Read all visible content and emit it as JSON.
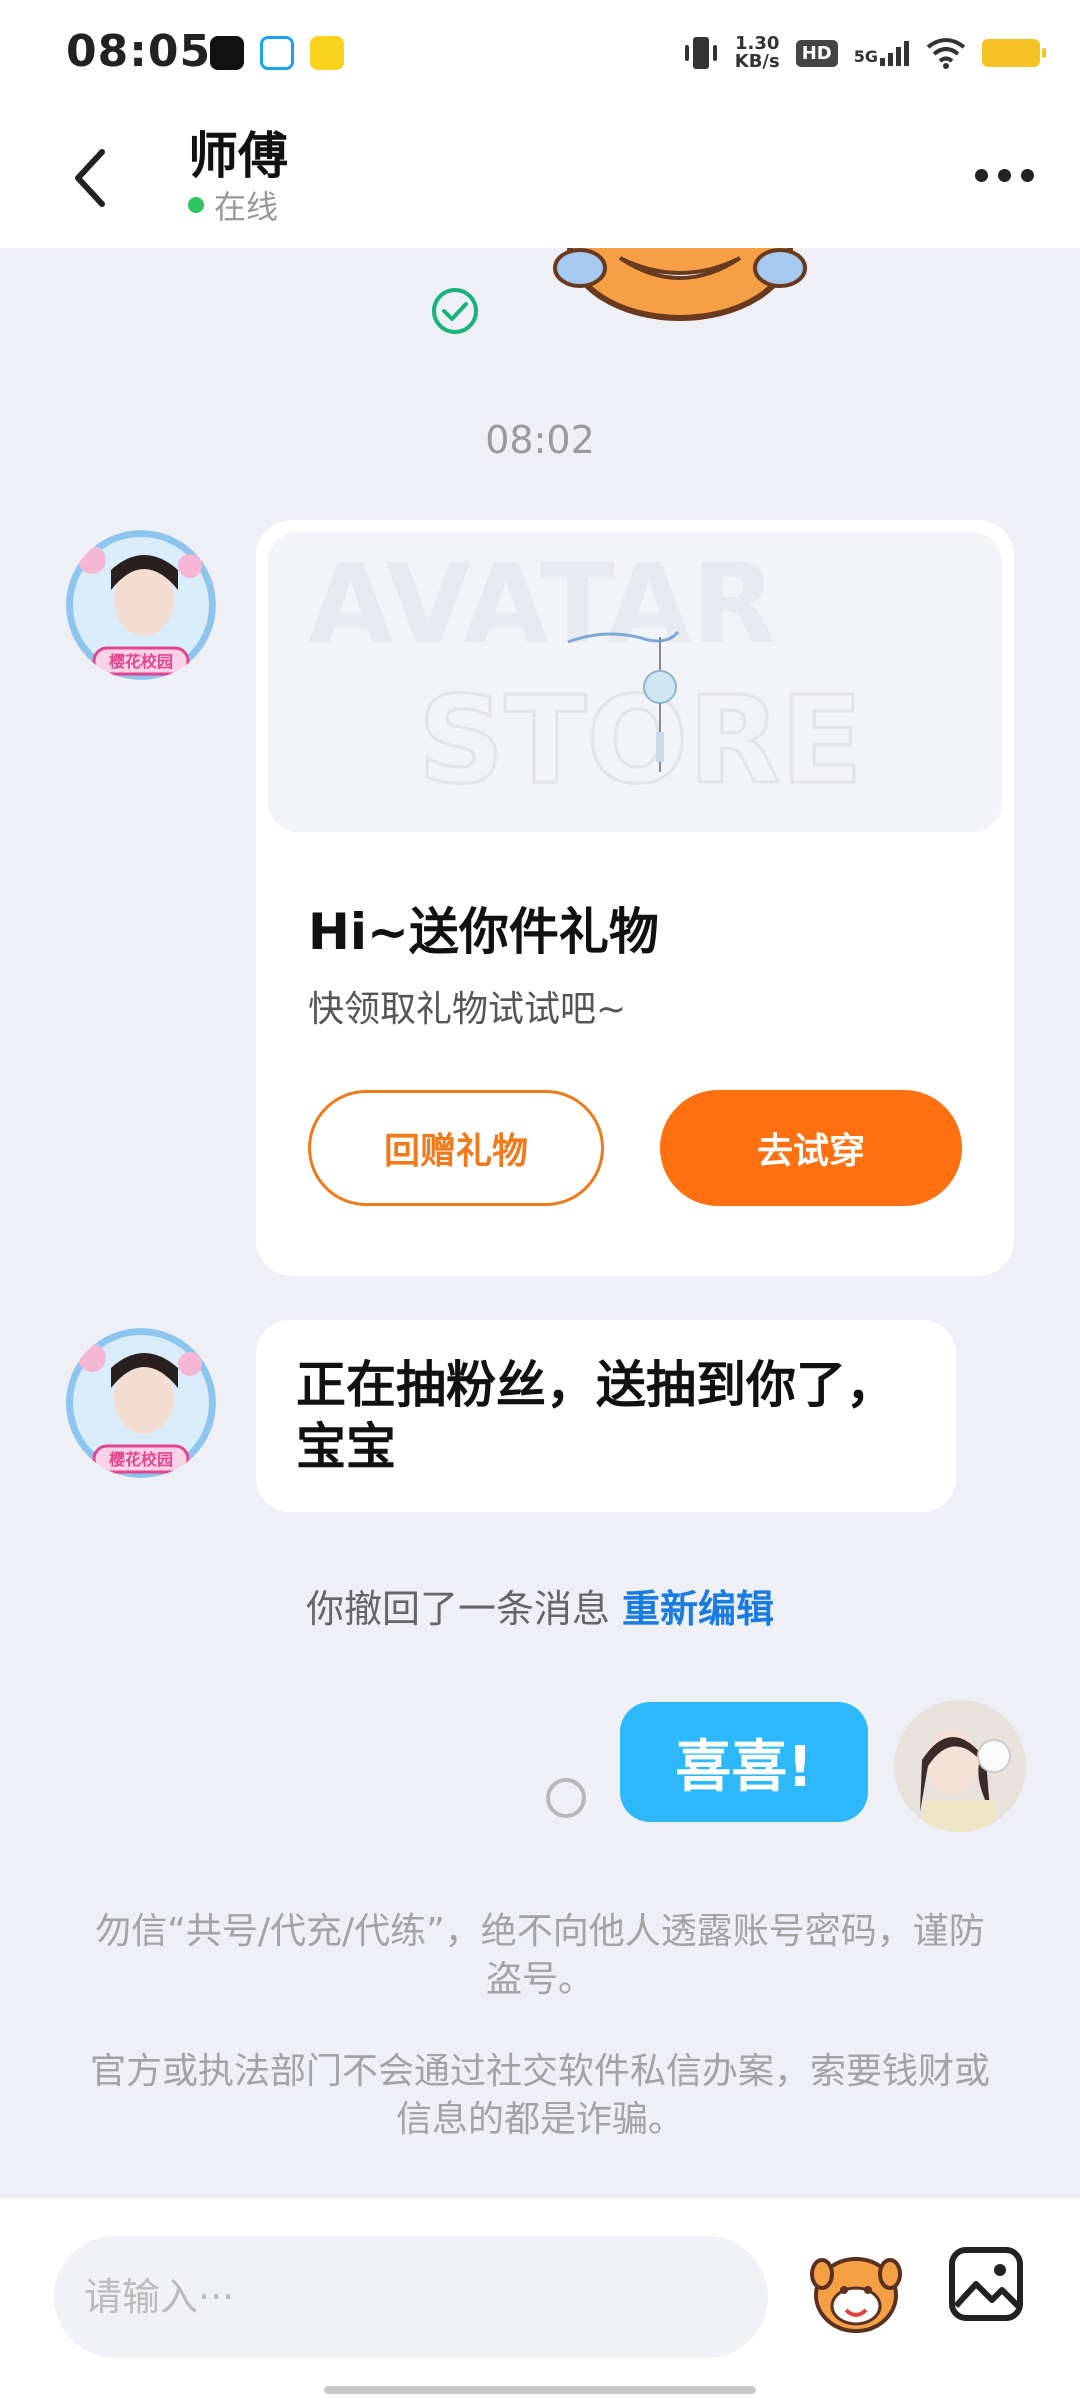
{
  "status_bar": {
    "time": "08:05",
    "net_speed_value": "1.30",
    "net_speed_unit": "KB/s",
    "hd_badge": "HD",
    "network": "5G"
  },
  "header": {
    "contact_name": "师傅",
    "status_text": "在线"
  },
  "chat": {
    "timestamp": "08:02",
    "gift_card": {
      "title": "Hi~送你件礼物",
      "subtitle": "快领取礼物试试吧~",
      "return_gift_label": "回赠礼物",
      "try_on_label": "去试穿",
      "banner_text_1": "AVATAR",
      "banner_text_2": "STORE"
    },
    "incoming_text": "正在抽粉丝，送抽到你了，宝宝",
    "recall_notice": "你撤回了一条消息",
    "recall_edit_label": "重新编辑",
    "outgoing_text": "喜喜!",
    "warning_1": "勿信“共号/代充/代练”，绝不向他人透露账号密码，谨防盗号。",
    "warning_2": "官方或执法部门不会通过社交软件私信办案，索要钱财或信息的都是诈骗。",
    "avatar_badge": "樱花校园"
  },
  "input": {
    "placeholder": "请输入···"
  },
  "colors": {
    "accent_orange": "#ff7010",
    "bubble_blue": "#2db8fb",
    "link_blue": "#1a7be0",
    "online_green": "#2dc55e"
  },
  "icons": {
    "back": "back-arrow-icon",
    "more": "more-dots-icon",
    "read": "check-circle-icon",
    "sticker": "sticker-icon",
    "image": "image-icon"
  }
}
